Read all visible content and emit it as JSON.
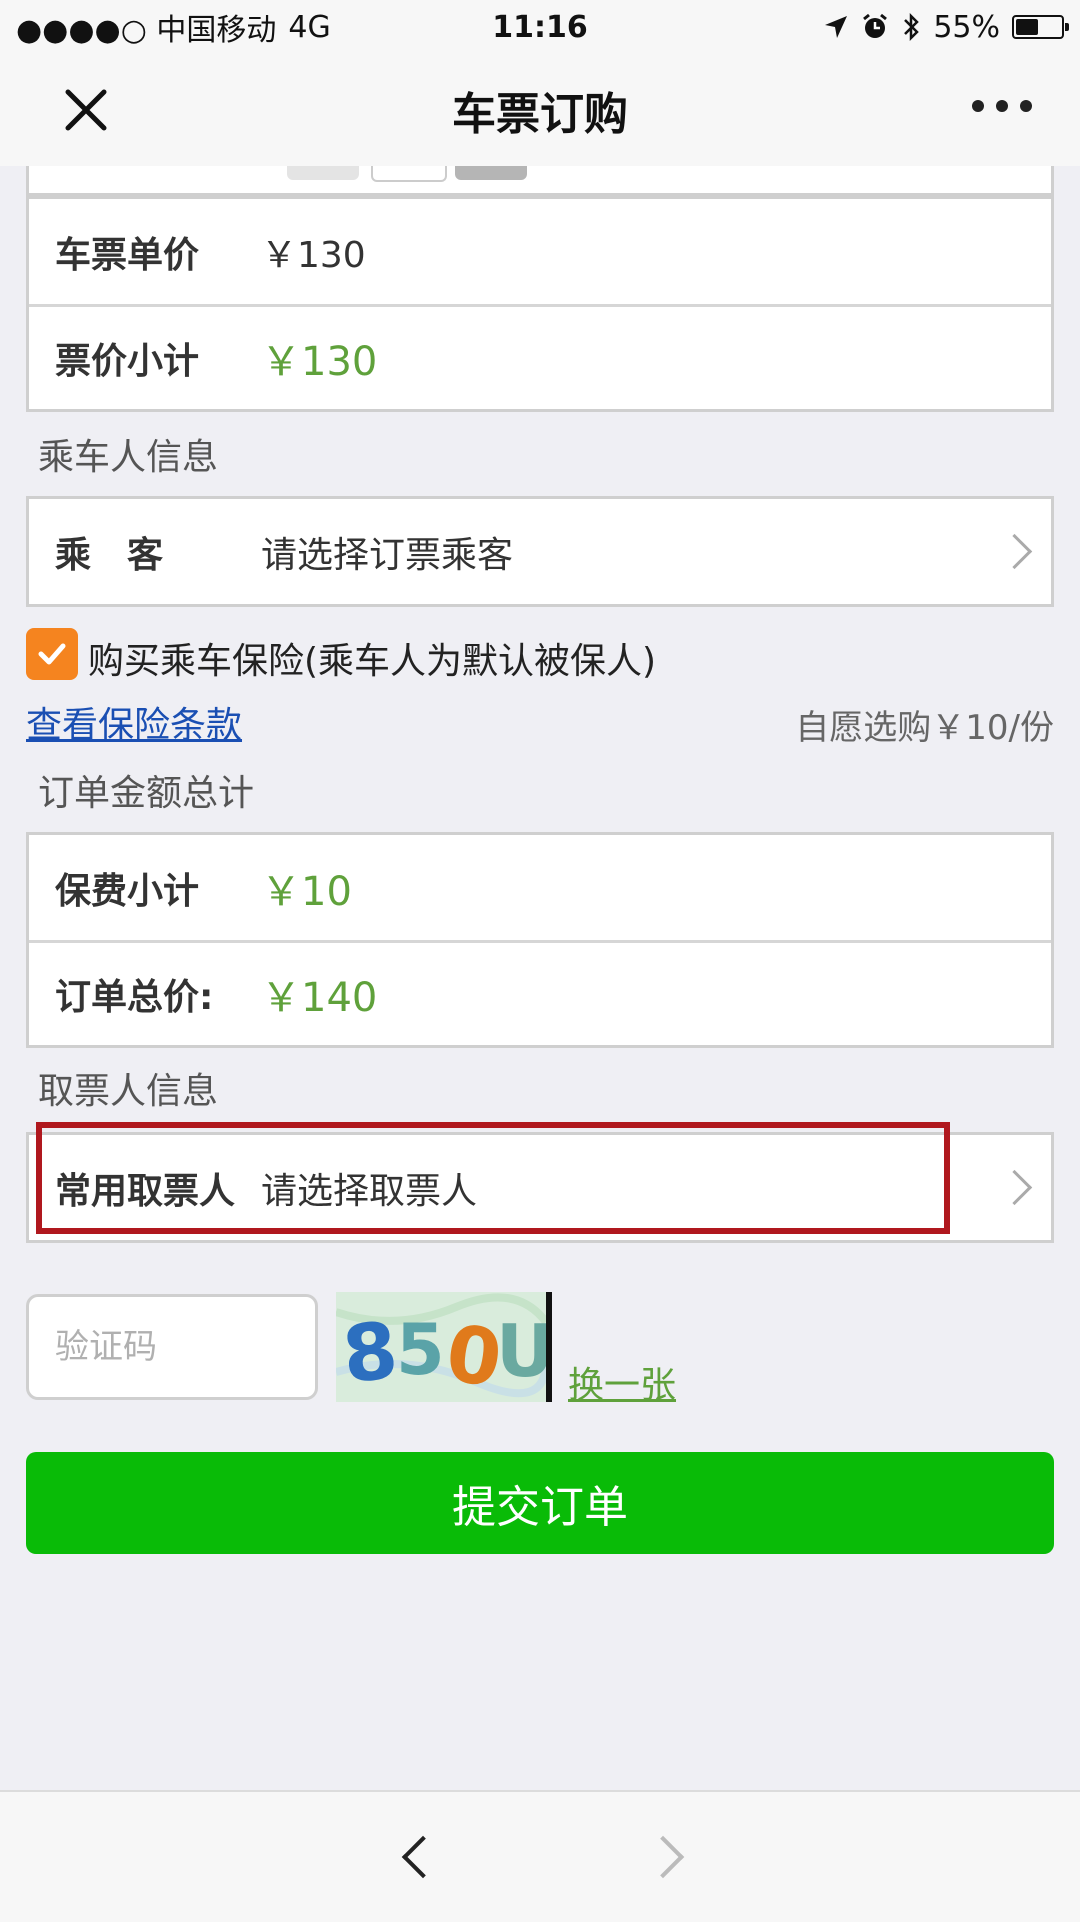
{
  "status_bar": {
    "carrier": "●●●●○ 中国移动",
    "network": "4G",
    "time": "11:16",
    "battery": "55%",
    "battery_level_percent": 55
  },
  "nav": {
    "title": "车票订购",
    "icons": [
      "close-icon",
      "more-icon"
    ]
  },
  "ticket": {
    "price_label": "车票单价",
    "price_value": "￥130",
    "subtotal_label": "票价小计",
    "subtotal_value": "￥130"
  },
  "passenger": {
    "section_title": "乘车人信息",
    "label": "乘　客",
    "placeholder": "请选择订票乘客"
  },
  "insurance": {
    "checked": true,
    "label": "购买乘车保险(乘车人为默认被保人)",
    "terms_link": "查看保险条款",
    "price_note": "自愿选购￥10/份"
  },
  "order_total": {
    "section_title": "订单金额总计",
    "premium_label": "保费小计",
    "premium_value": "￥10",
    "total_label": "订单总价:",
    "total_value": "￥140"
  },
  "collector": {
    "section_title": "取票人信息",
    "label": "常用取票人",
    "placeholder": "请选择取票人"
  },
  "captcha": {
    "placeholder": "验证码",
    "image_text": "850U",
    "refresh_label": "换一张"
  },
  "submit_label": "提交订单",
  "colors": {
    "accent_green": "#09bb07",
    "price_green": "#5fa13b",
    "checkbox_orange": "#f5841f",
    "link_blue": "#1a4fb3",
    "highlight_red": "#b0181e"
  }
}
